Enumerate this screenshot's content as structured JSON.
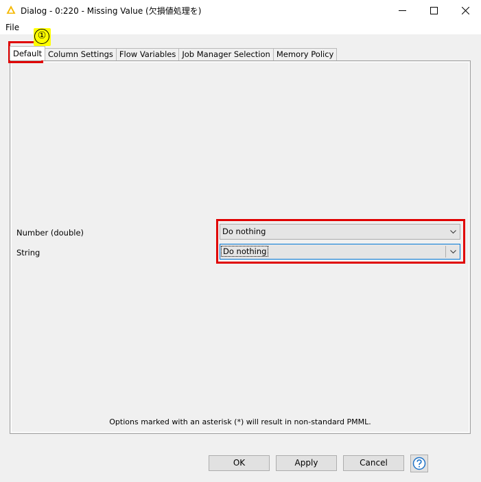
{
  "window": {
    "title": "Dialog - 0:220 - Missing Value (欠損値処理を)",
    "icon": "knime-warning-triangle-icon",
    "controls": [
      "minimize-icon",
      "maximize-icon",
      "close-icon"
    ]
  },
  "menu": {
    "file_label": "File"
  },
  "annotation": {
    "marker": "①",
    "highlight_color": "#e00000",
    "marker_bg": "#ffff00"
  },
  "tabs": [
    {
      "label": "Default",
      "active": true
    },
    {
      "label": "Column Settings",
      "active": false
    },
    {
      "label": "Flow Variables",
      "active": false
    },
    {
      "label": "Job Manager Selection",
      "active": false
    },
    {
      "label": "Memory Policy",
      "active": false
    }
  ],
  "settings": {
    "number": {
      "label": "Number (double)",
      "value": "Do nothing"
    },
    "string": {
      "label": "String",
      "value": "Do nothing"
    }
  },
  "footnote": "Options marked with an asterisk (*) will result in non-standard PMML.",
  "buttons": {
    "ok": "OK",
    "apply": "Apply",
    "cancel": "Cancel",
    "help_icon": "question-mark-icon"
  }
}
